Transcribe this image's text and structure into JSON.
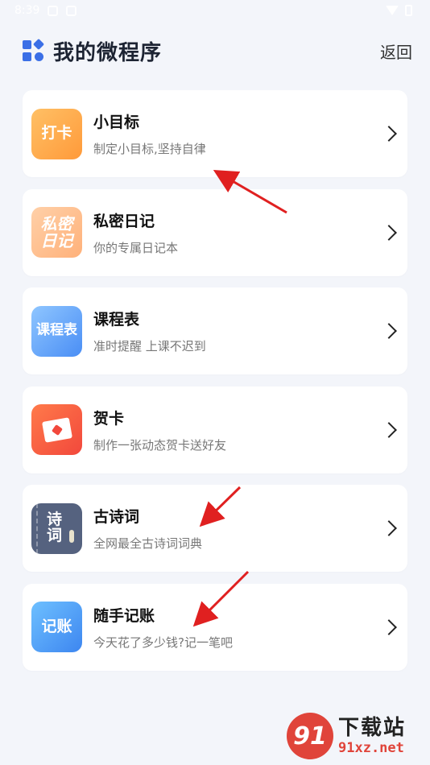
{
  "status_bar": {
    "time": "8:39"
  },
  "header": {
    "title": "我的微程序",
    "back_label": "返回"
  },
  "items": [
    {
      "title": "小目标",
      "desc": "制定小目标,坚持自律",
      "icon_text": "打卡",
      "icon": "checkin-icon"
    },
    {
      "title": "私密日记",
      "desc": "你的专属日记本",
      "icon_line1": "私密",
      "icon_line2": "日记",
      "icon": "diary-icon"
    },
    {
      "title": "课程表",
      "desc": "准时提醒 上课不迟到",
      "icon_text": "课程表",
      "icon": "schedule-icon"
    },
    {
      "title": "贺卡",
      "desc": "制作一张动态贺卡送好友",
      "icon": "greeting-card-icon"
    },
    {
      "title": "古诗词",
      "desc": "全网最全古诗词词典",
      "icon_line1": "诗",
      "icon_line2": "词",
      "icon": "poem-icon"
    },
    {
      "title": "随手记账",
      "desc": "今天花了多少钱?记一笔吧",
      "icon_text": "记账",
      "icon": "account-icon"
    }
  ],
  "watermark": {
    "logo_text": "91",
    "name": "下载站",
    "url": "91xz.net"
  },
  "colors": {
    "accent": "#3b6fe6",
    "arrow": "#e02020",
    "background": "#f3f5fa"
  }
}
